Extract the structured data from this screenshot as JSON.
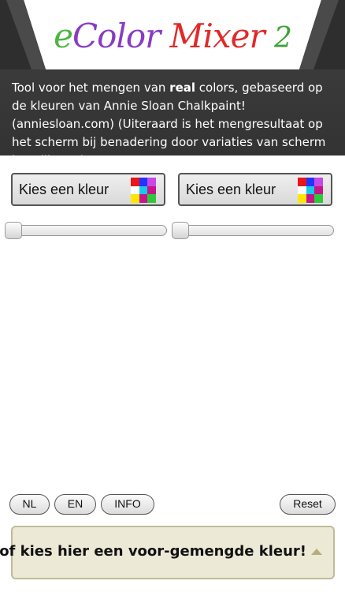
{
  "header": {
    "logo": {
      "prefix": "e",
      "color_word": "Color",
      "mixer_word": "Mixer",
      "number": "2"
    },
    "intro": {
      "part1": "Tool voor het mengen van ",
      "bold": "real",
      "part2": " colors, gebaseerd op de kleuren van Annie Sloan Chalkpaint! (anniesloan.com) (Uiteraard is het mengresultaat op het scherm bij benadering door variaties van scherm instellingen)"
    }
  },
  "pickers": [
    {
      "label": "Kies een kleur"
    },
    {
      "label": "Kies een kleur"
    }
  ],
  "swatch_colors": [
    "#e8171c",
    "#2233ff",
    "#c848e8",
    "#ffffff",
    "#17c8e8",
    "#c7148a",
    "#ffe600",
    "#c7148a",
    "#2fc83a"
  ],
  "sliders": [
    {
      "value": 0
    },
    {
      "value": 0
    }
  ],
  "buttons": {
    "nl": "NL",
    "en": "EN",
    "info": "INFO",
    "reset": "Reset"
  },
  "premix": {
    "label": "of kies hier een voor-gemengde kleur!"
  },
  "colors": {
    "header_bg": "#3a3a3a",
    "premix_bg": "#ece9d7"
  }
}
